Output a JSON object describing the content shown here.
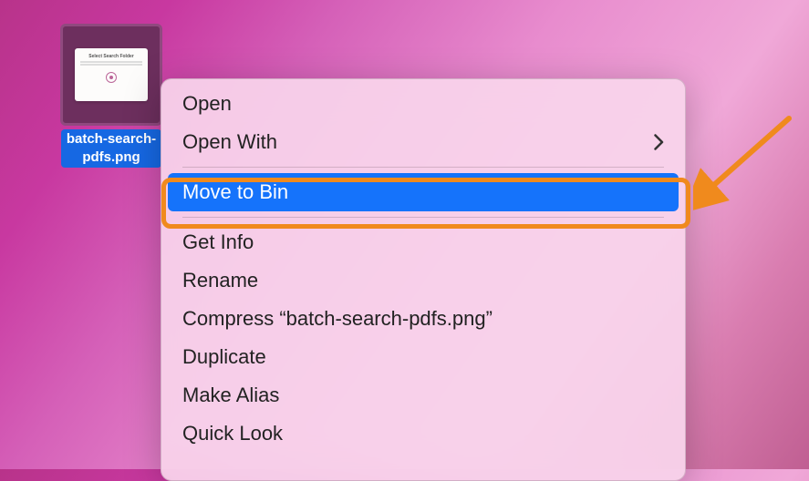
{
  "desktop": {
    "file": {
      "label": "batch-search-\npdfs.png",
      "thumbnail_text": "Select Search Folder"
    }
  },
  "context_menu": {
    "groups": [
      {
        "items": [
          {
            "label": "Open",
            "submenu": false
          },
          {
            "label": "Open With",
            "submenu": true
          }
        ]
      },
      {
        "items": [
          {
            "label": "Move to Bin",
            "submenu": false,
            "highlighted": true
          }
        ]
      },
      {
        "items": [
          {
            "label": "Get Info",
            "submenu": false
          },
          {
            "label": "Rename",
            "submenu": false
          },
          {
            "label": "Compress “batch-search-pdfs.png”",
            "submenu": false
          },
          {
            "label": "Duplicate",
            "submenu": false
          },
          {
            "label": "Make Alias",
            "submenu": false
          },
          {
            "label": "Quick Look",
            "submenu": false
          }
        ]
      }
    ]
  },
  "annotation": {
    "color": "#f08a1d"
  }
}
